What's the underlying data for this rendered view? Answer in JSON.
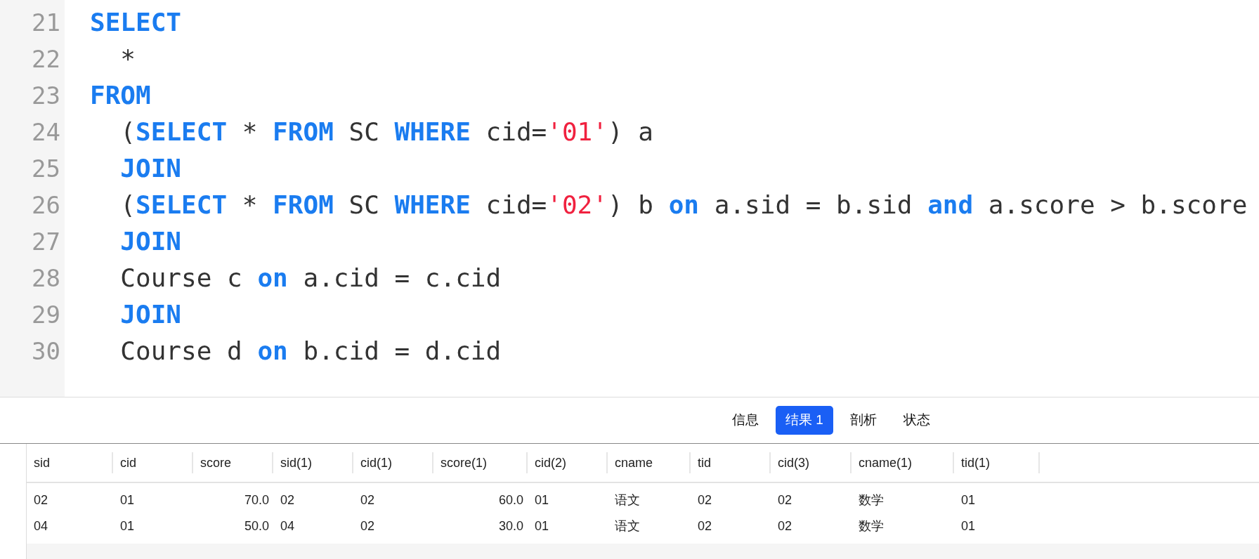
{
  "editor": {
    "lines": [
      {
        "number": "21",
        "indented": false,
        "tokens": [
          {
            "kind": "keyword",
            "text": "SELECT"
          }
        ]
      },
      {
        "number": "22",
        "indented": true,
        "tokens": [
          {
            "kind": "plain",
            "text": "*"
          }
        ]
      },
      {
        "number": "23",
        "indented": false,
        "tokens": [
          {
            "kind": "keyword",
            "text": "FROM"
          }
        ]
      },
      {
        "number": "24",
        "indented": true,
        "tokens": [
          {
            "kind": "plain",
            "text": "("
          },
          {
            "kind": "keyword",
            "text": "SELECT"
          },
          {
            "kind": "plain",
            "text": " * "
          },
          {
            "kind": "keyword",
            "text": "FROM"
          },
          {
            "kind": "plain",
            "text": " SC "
          },
          {
            "kind": "keyword",
            "text": "WHERE"
          },
          {
            "kind": "plain",
            "text": " cid="
          },
          {
            "kind": "string",
            "text": "'01'"
          },
          {
            "kind": "plain",
            "text": ") a"
          }
        ]
      },
      {
        "number": "25",
        "indented": true,
        "tokens": [
          {
            "kind": "keyword",
            "text": "JOIN"
          }
        ]
      },
      {
        "number": "26",
        "indented": true,
        "tokens": [
          {
            "kind": "plain",
            "text": "("
          },
          {
            "kind": "keyword",
            "text": "SELECT"
          },
          {
            "kind": "plain",
            "text": " * "
          },
          {
            "kind": "keyword",
            "text": "FROM"
          },
          {
            "kind": "plain",
            "text": " SC "
          },
          {
            "kind": "keyword",
            "text": "WHERE"
          },
          {
            "kind": "plain",
            "text": " cid="
          },
          {
            "kind": "string",
            "text": "'02'"
          },
          {
            "kind": "plain",
            "text": ") b "
          },
          {
            "kind": "keyword",
            "text": "on"
          },
          {
            "kind": "plain",
            "text": " a.sid = b.sid "
          },
          {
            "kind": "keyword",
            "text": "and"
          },
          {
            "kind": "plain",
            "text": " a.score > b.score"
          }
        ]
      },
      {
        "number": "27",
        "indented": true,
        "tokens": [
          {
            "kind": "keyword",
            "text": "JOIN"
          }
        ]
      },
      {
        "number": "28",
        "indented": true,
        "tokens": [
          {
            "kind": "plain",
            "text": "Course c "
          },
          {
            "kind": "keyword",
            "text": "on"
          },
          {
            "kind": "plain",
            "text": " a.cid = c.cid"
          }
        ]
      },
      {
        "number": "29",
        "indented": true,
        "tokens": [
          {
            "kind": "keyword",
            "text": "JOIN"
          }
        ]
      },
      {
        "number": "30",
        "indented": true,
        "tokens": [
          {
            "kind": "plain",
            "text": "Course d "
          },
          {
            "kind": "keyword",
            "text": "on"
          },
          {
            "kind": "plain",
            "text": " b.cid = d.cid"
          }
        ]
      }
    ]
  },
  "tabs": [
    {
      "label": "信息",
      "selected": false
    },
    {
      "label": "结果 1",
      "selected": true
    },
    {
      "label": "剖析",
      "selected": false
    },
    {
      "label": "状态",
      "selected": false
    }
  ],
  "table": {
    "columns": [
      {
        "label": "sid",
        "numeric": false
      },
      {
        "label": "cid",
        "numeric": false
      },
      {
        "label": "score",
        "numeric": true
      },
      {
        "label": "sid(1)",
        "numeric": false
      },
      {
        "label": "cid(1)",
        "numeric": false
      },
      {
        "label": "score(1)",
        "numeric": true
      },
      {
        "label": "cid(2)",
        "numeric": false
      },
      {
        "label": "cname",
        "numeric": false
      },
      {
        "label": "tid",
        "numeric": false
      },
      {
        "label": "cid(3)",
        "numeric": false
      },
      {
        "label": "cname(1)",
        "numeric": false
      },
      {
        "label": "tid(1)",
        "numeric": false
      }
    ],
    "rows": [
      [
        "02",
        "01",
        "70.0",
        "02",
        "02",
        "60.0",
        "01",
        "语文",
        "02",
        "02",
        "数学",
        "01"
      ],
      [
        "04",
        "01",
        "50.0",
        "04",
        "02",
        "30.0",
        "01",
        "语文",
        "02",
        "02",
        "数学",
        "01"
      ]
    ]
  }
}
